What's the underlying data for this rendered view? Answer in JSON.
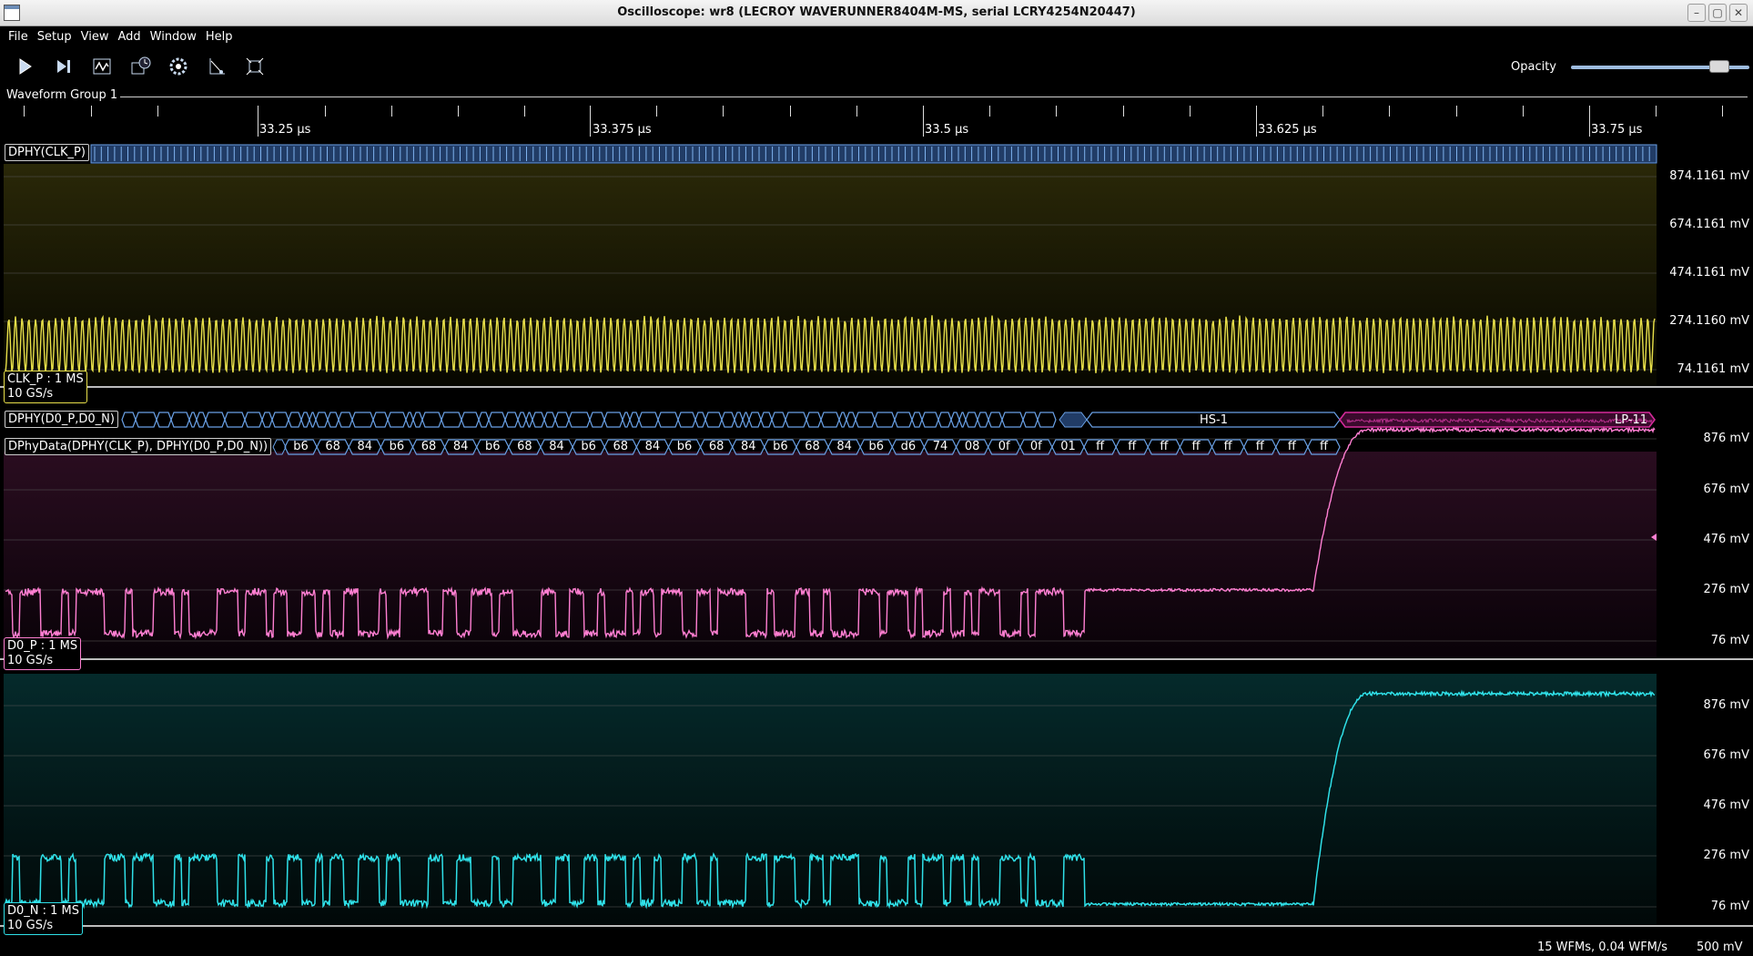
{
  "window": {
    "title": "Oscilloscope: wr8 (LECROY WAVERUNNER8404M-MS, serial LCRY4254N20447)",
    "controls": [
      "–",
      "▢",
      "✕"
    ]
  },
  "menu": [
    "File",
    "Setup",
    "View",
    "Add",
    "Window",
    "Help"
  ],
  "toolbar": {
    "buttons": [
      "run",
      "single",
      "waveform",
      "history",
      "settings",
      "measure",
      "fit"
    ],
    "opacity_label": "Opacity",
    "opacity_value": 0.83
  },
  "group": {
    "label": "Waveform Group 1"
  },
  "timebase": {
    "ticks": [
      "33.25 µs",
      "33.375 µs",
      "33.5 µs",
      "33.625 µs",
      "33.75 µs"
    ]
  },
  "colors": {
    "clk": "#e8e04a",
    "d0p": "#ff7fd2",
    "d0n": "#2fe0e8",
    "proto": "#5a8ad0",
    "lp": "#d42a9a"
  },
  "protocol": {
    "clk_label": "DPHY(CLK_P)",
    "data_label": "DPHY(D0_P,D0_N)",
    "hs_label": "HS-1",
    "lp_label": "LP-11",
    "decode_label": "DPhyData(DPHY(CLK_P), DPHY(D0_P,D0_N))",
    "bytes": [
      "b6",
      "68",
      "84",
      "b6",
      "68",
      "84",
      "b6",
      "68",
      "84",
      "b6",
      "68",
      "84",
      "b6",
      "68",
      "84",
      "b6",
      "68",
      "84",
      "b6",
      "d6",
      "74",
      "08",
      "0f",
      "0f",
      "01",
      "ff",
      "ff",
      "ff",
      "ff",
      "ff",
      "ff",
      "ff",
      "ff"
    ]
  },
  "channels": {
    "clk": {
      "label": "CLK_P : 1 MS",
      "rate": "10 GS/s",
      "axis": [
        "874.1161 mV",
        "674.1161 mV",
        "474.1161 mV",
        "274.1160 mV",
        "74.1161 mV"
      ]
    },
    "d0p": {
      "label": "D0_P : 1 MS",
      "rate": "10 GS/s",
      "axis": [
        "876 mV",
        "676 mV",
        "476 mV",
        "276 mV",
        "76 mV"
      ]
    },
    "d0n": {
      "label": "D0_N : 1 MS",
      "rate": "10 GS/s",
      "axis": [
        "876 mV",
        "676 mV",
        "476 mV",
        "276 mV",
        "76 mV"
      ]
    }
  },
  "status": {
    "rate": "15 WFMs, 0.04 WFM/s",
    "scale": "500 mV"
  }
}
